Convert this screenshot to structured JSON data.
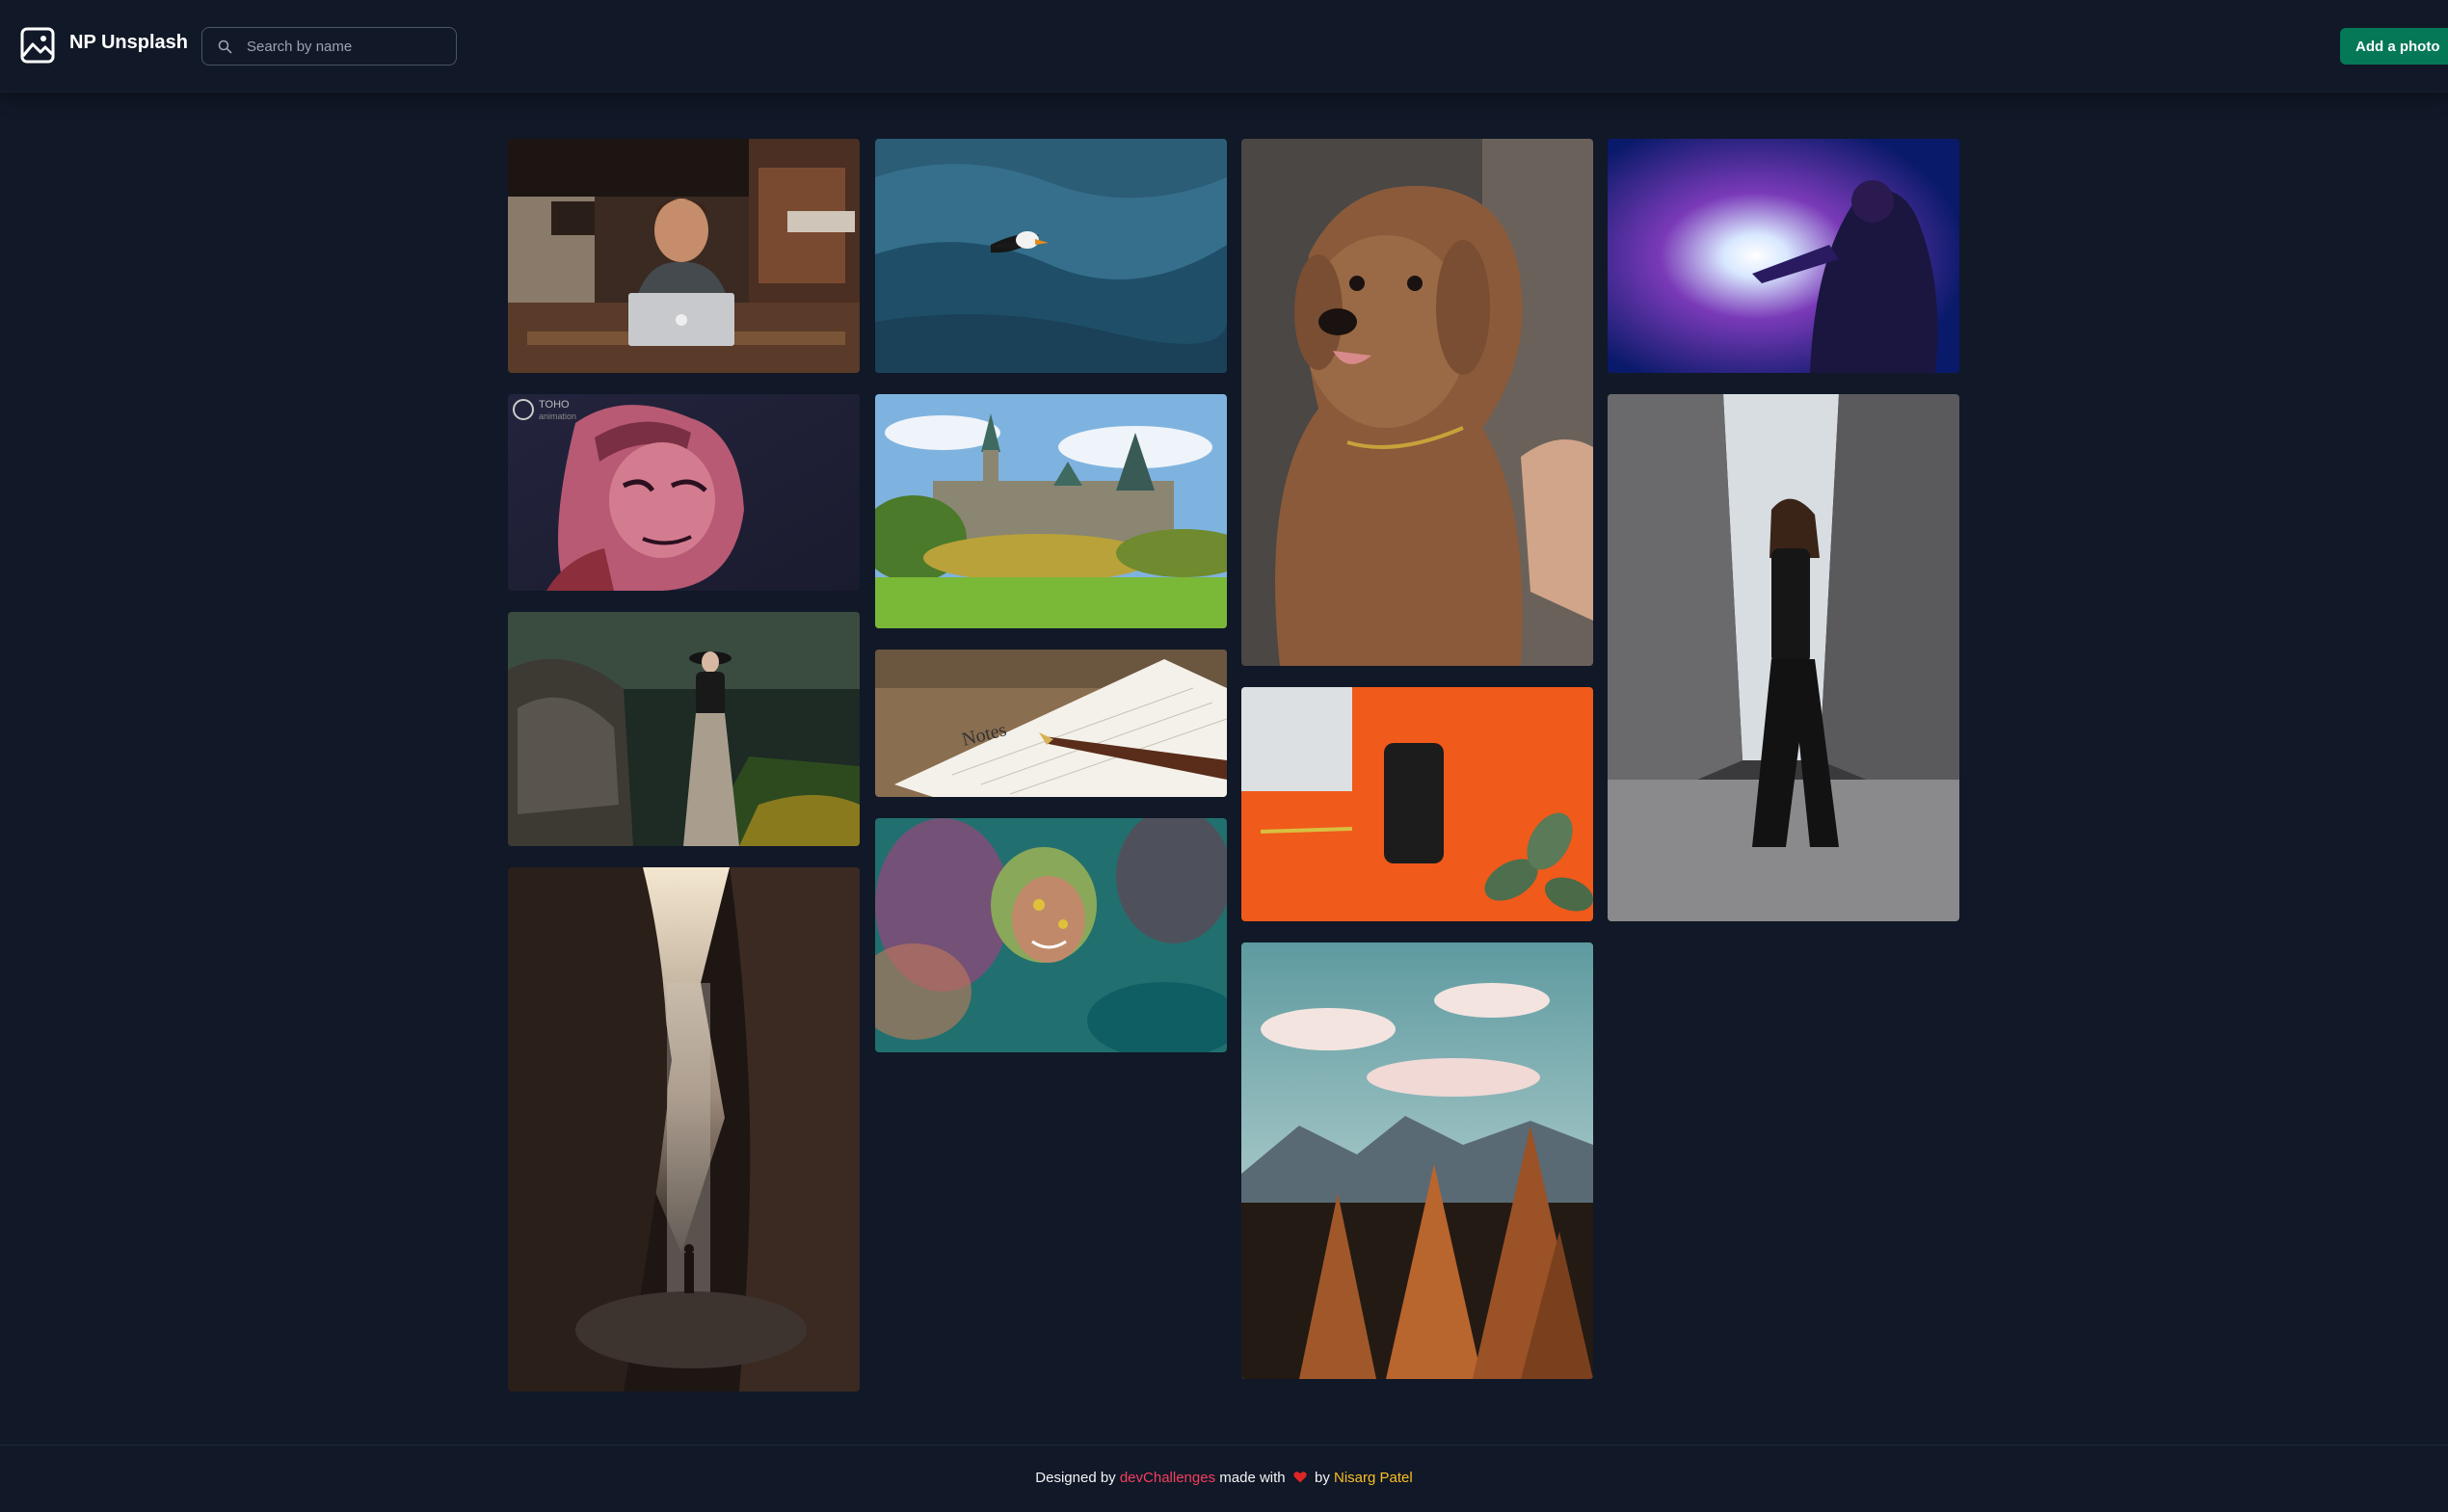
{
  "header": {
    "brand": "NP Unsplash",
    "logo_icon": "image-icon",
    "search": {
      "placeholder": "Search by name",
      "value": "",
      "icon": "search-icon"
    },
    "add_button_label": "Add a photo"
  },
  "colors": {
    "background": "#111827",
    "accent": "#047857",
    "dev_link": "#f43f5e",
    "author_link": "#fbbf24"
  },
  "gallery": {
    "photos": [
      {
        "name": "photo-man-laptop-cafe"
      },
      {
        "name": "photo-anime-character"
      },
      {
        "name": "photo-woman-hat-forest"
      },
      {
        "name": "photo-cave-waterfall"
      },
      {
        "name": "photo-puffin-ocean"
      },
      {
        "name": "photo-parliament-castle"
      },
      {
        "name": "photo-notebook-pen"
      },
      {
        "name": "photo-girl-holi-colors"
      },
      {
        "name": "photo-curly-dog"
      },
      {
        "name": "photo-orange-desk-phone"
      },
      {
        "name": "photo-mountain-pines"
      },
      {
        "name": "photo-projector-light"
      },
      {
        "name": "photo-woman-under-bridge"
      }
    ],
    "overlay_text": {
      "anime_watermark": "TOHO animation",
      "notebook_text": "Notes"
    }
  },
  "footer": {
    "prefix": "Designed by",
    "dev_link": "devChallenges",
    "made_with": "made with",
    "heart_icon": "heart-icon",
    "by": "by",
    "author": "Nisarg Patel"
  }
}
